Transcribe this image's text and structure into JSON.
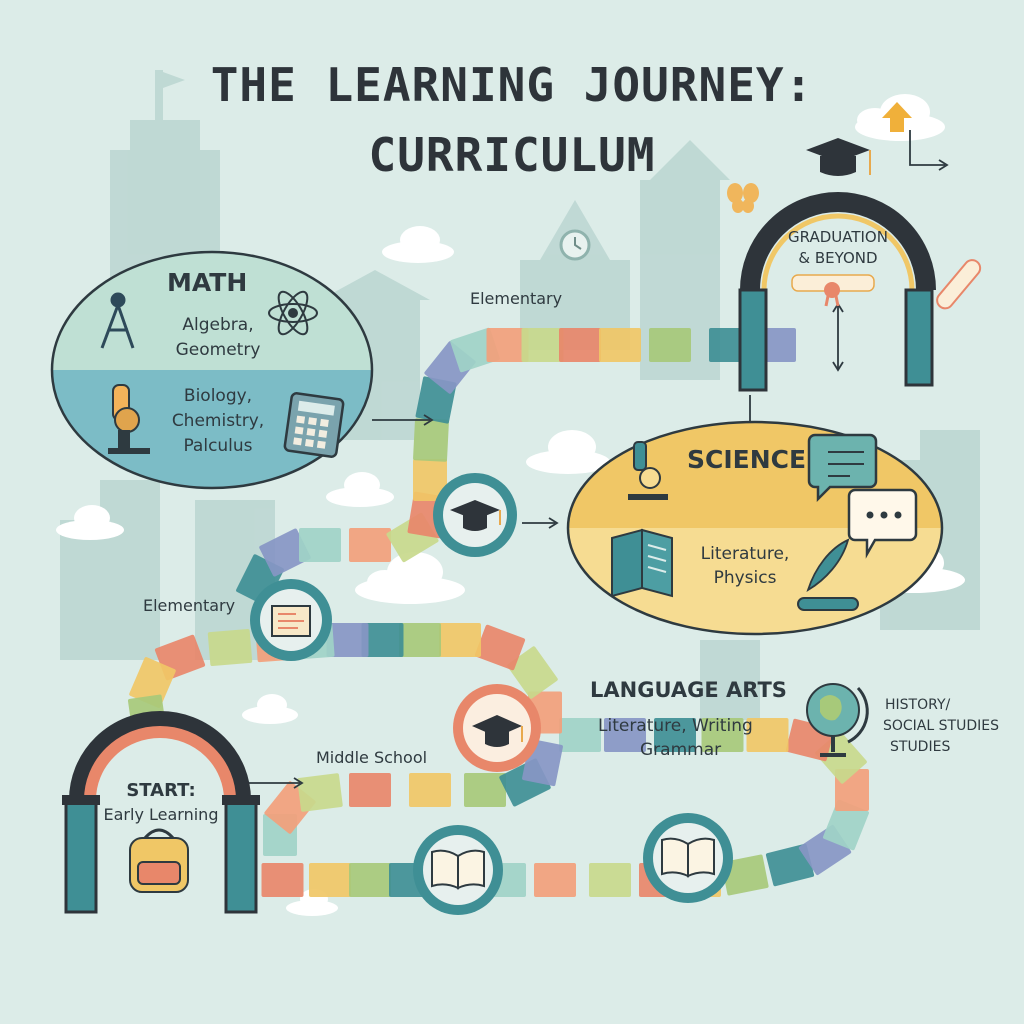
{
  "title": {
    "line1": "THE LEARNING JOURNEY:",
    "line2": "CURRICULUM"
  },
  "palette": {
    "background": "#dcece8",
    "teal": "#3f8f95",
    "orange": "#e8876a",
    "yellow": "#f0c766",
    "green": "#a7c97a",
    "lavender": "#8796c4",
    "dark": "#2e343a"
  },
  "start": {
    "line1": "START:",
    "line2": "Early Learning",
    "icon": "backpack-icon"
  },
  "stage_labels": {
    "elementary_top": "Elementary",
    "elementary_mid": "Elementary",
    "middle_school": "Middle School"
  },
  "math": {
    "heading": "MATH",
    "line1": "Algebra,",
    "line2": "Geometry",
    "line3": "Biology,",
    "line4": "Chemistry,",
    "line5": "Palculus",
    "icons": [
      "compass-icon",
      "atom-icon",
      "microscope-icon",
      "calculator-icon"
    ]
  },
  "science": {
    "heading": "SCIENCE",
    "line1": "Literature,",
    "line2": "Physics",
    "icons": [
      "microscope-icon",
      "speech-bubble-icon",
      "book-icon",
      "quill-icon",
      "scroll-icon"
    ]
  },
  "language_arts": {
    "heading": "LANGUAGE ARTS",
    "line1": "Literature, Writing",
    "line2": "Grammar"
  },
  "history": {
    "line1": "HISTORY/",
    "line2": "SOCIAL STUDIES",
    "line3": "STUDIES",
    "icon": "globe-icon"
  },
  "graduation": {
    "line1": "GRADUATION",
    "line2": "& BEYOND",
    "icons": [
      "graduation-cap-icon",
      "diploma-icon",
      "butterfly-icon"
    ]
  }
}
